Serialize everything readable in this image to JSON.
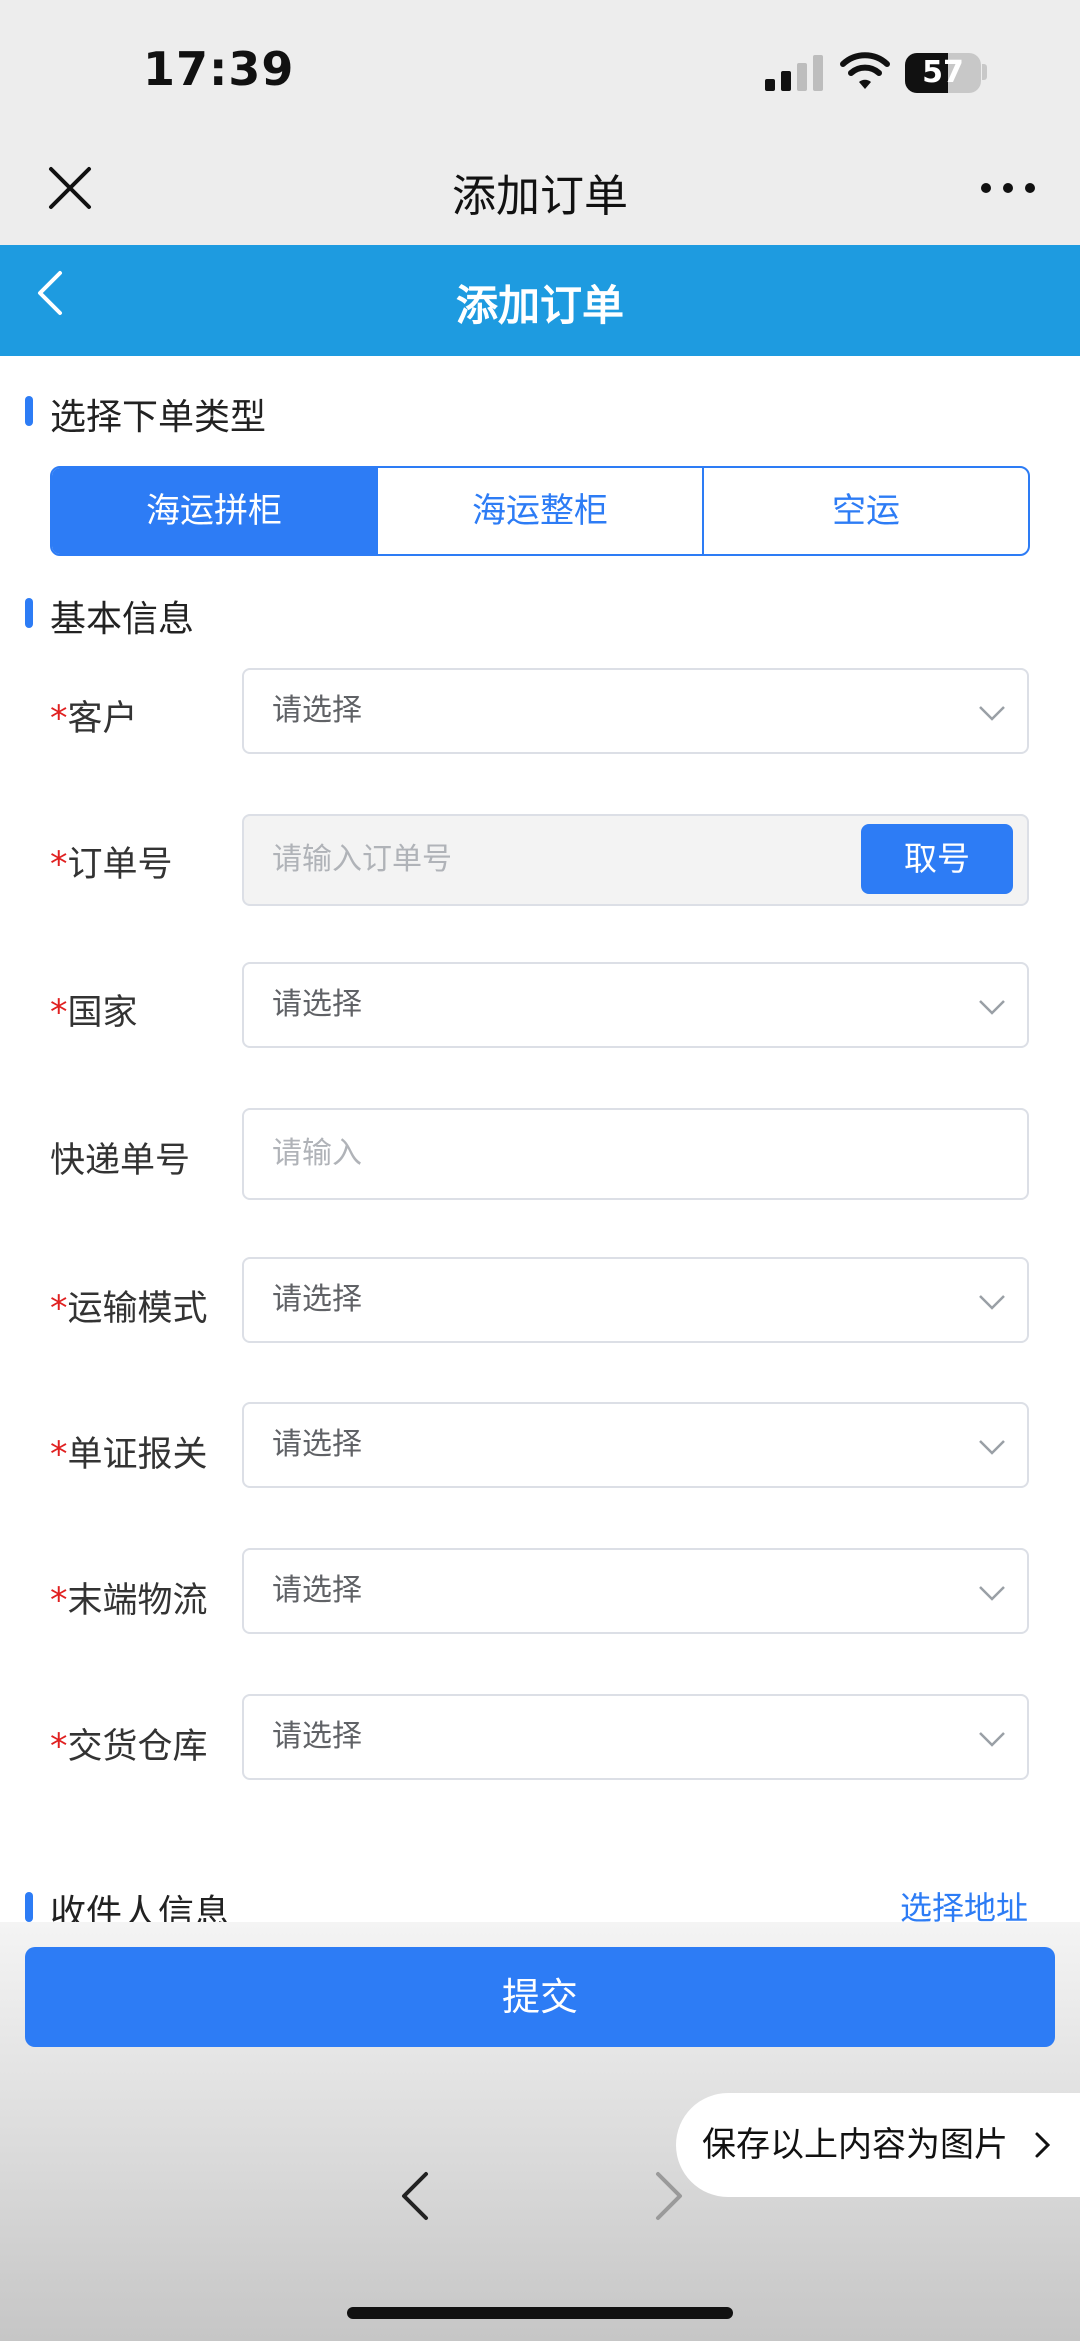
{
  "status_bar": {
    "time": "17:39",
    "battery": "57",
    "battery_level": 0.57
  },
  "wechat_bar": {
    "title": "添加订单"
  },
  "header": {
    "title": "添加订单"
  },
  "order_type": {
    "section_title": "选择下单类型",
    "options": [
      "海运拼柜",
      "海运整柜",
      "空运"
    ],
    "selected_index": 0
  },
  "basic_info": {
    "section_title": "基本信息",
    "required_mark": "*",
    "fields": [
      {
        "label": "客户",
        "required": true,
        "placeholder": "请选择",
        "kind": "select"
      },
      {
        "label": "订单号",
        "required": true,
        "placeholder": "请输入订单号",
        "kind": "disabled-input",
        "action": "取号"
      },
      {
        "label": "国家",
        "required": true,
        "placeholder": "请选择",
        "kind": "select"
      },
      {
        "label": "快递单号",
        "required": false,
        "placeholder": "请输入",
        "kind": "input"
      },
      {
        "label": "运输模式",
        "required": true,
        "placeholder": "请选择",
        "kind": "select"
      },
      {
        "label": "单证报关",
        "required": true,
        "placeholder": "请选择",
        "kind": "select"
      },
      {
        "label": "末端物流",
        "required": true,
        "placeholder": "请选择",
        "kind": "select"
      },
      {
        "label": "交货仓库",
        "required": true,
        "placeholder": "请选择",
        "kind": "select"
      }
    ]
  },
  "receiver": {
    "section_title": "收件人信息",
    "link": "选择地址"
  },
  "footer": {
    "submit": "提交",
    "save_image": "保存以上内容为图片"
  },
  "colors": {
    "primary": "#2d7cf5",
    "header": "#1e9be0",
    "required": "#e02020"
  }
}
